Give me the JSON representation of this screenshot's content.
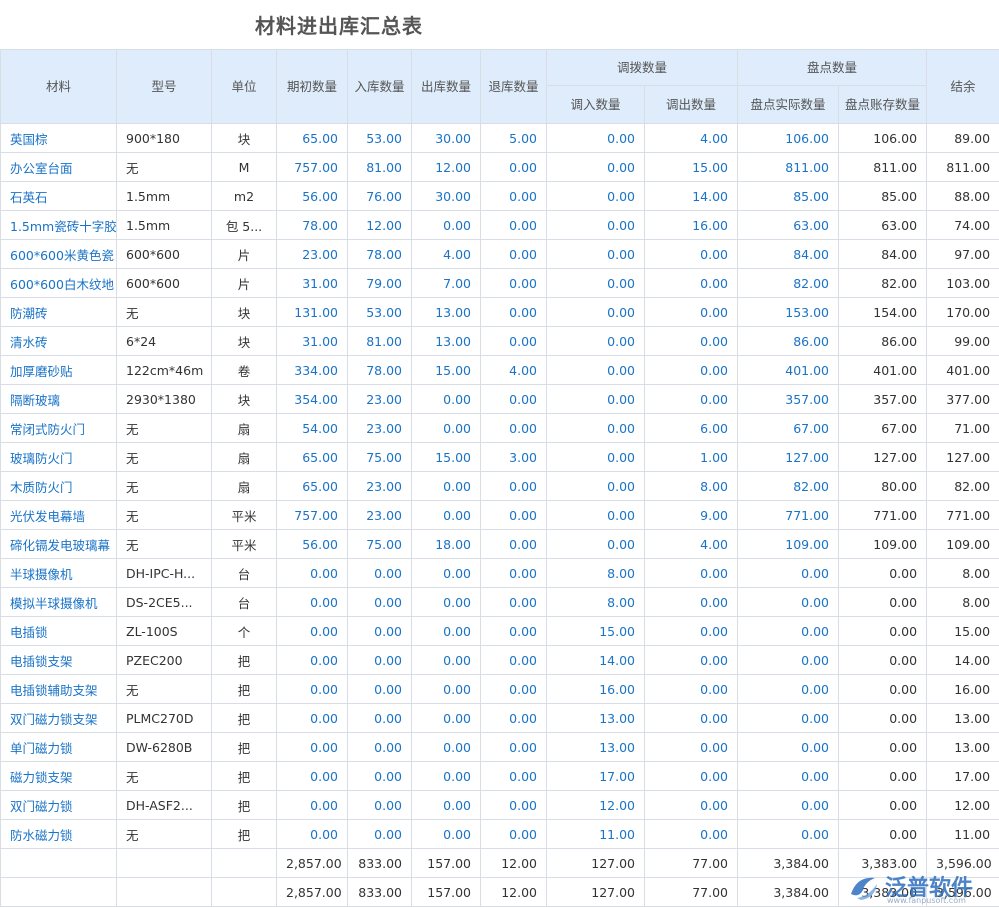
{
  "page_title": "材料进出库汇总表",
  "header": {
    "material": "材料",
    "model": "型号",
    "unit": "单位",
    "opening_qty": "期初数量",
    "in_qty": "入库数量",
    "out_qty": "出库数量",
    "return_qty": "退库数量",
    "transfer_group": "调拨数量",
    "transfer_in": "调入数量",
    "transfer_out": "调出数量",
    "inventory_group": "盘点数量",
    "inventory_actual": "盘点实际数量",
    "inventory_book": "盘点账存数量",
    "balance": "结余"
  },
  "rows": [
    {
      "material": "英国棕",
      "model": "900*180",
      "unit": "块",
      "opening": "65.00",
      "in": "53.00",
      "out": "30.00",
      "ret": "5.00",
      "tin": "0.00",
      "tout": "4.00",
      "actual": "106.00",
      "book": "106.00",
      "balance": "89.00"
    },
    {
      "material": "办公室台面",
      "model": "无",
      "unit": "M",
      "opening": "757.00",
      "in": "81.00",
      "out": "12.00",
      "ret": "0.00",
      "tin": "0.00",
      "tout": "15.00",
      "actual": "811.00",
      "book": "811.00",
      "balance": "811.00"
    },
    {
      "material": "石英石",
      "model": "1.5mm",
      "unit": "m2",
      "opening": "56.00",
      "in": "76.00",
      "out": "30.00",
      "ret": "0.00",
      "tin": "0.00",
      "tout": "14.00",
      "actual": "85.00",
      "book": "85.00",
      "balance": "88.00"
    },
    {
      "material": "1.5mm瓷砖十字胶",
      "model": "1.5mm",
      "unit": "包 5...",
      "opening": "78.00",
      "in": "12.00",
      "out": "0.00",
      "ret": "0.00",
      "tin": "0.00",
      "tout": "16.00",
      "actual": "63.00",
      "book": "63.00",
      "balance": "74.00"
    },
    {
      "material": "600*600米黄色瓷",
      "model": "600*600",
      "unit": "片",
      "opening": "23.00",
      "in": "78.00",
      "out": "4.00",
      "ret": "0.00",
      "tin": "0.00",
      "tout": "0.00",
      "actual": "84.00",
      "book": "84.00",
      "balance": "97.00"
    },
    {
      "material": "600*600白木纹地",
      "model": "600*600",
      "unit": "片",
      "opening": "31.00",
      "in": "79.00",
      "out": "7.00",
      "ret": "0.00",
      "tin": "0.00",
      "tout": "0.00",
      "actual": "82.00",
      "book": "82.00",
      "balance": "103.00"
    },
    {
      "material": "防潮砖",
      "model": "无",
      "unit": "块",
      "opening": "131.00",
      "in": "53.00",
      "out": "13.00",
      "ret": "0.00",
      "tin": "0.00",
      "tout": "0.00",
      "actual": "153.00",
      "book": "154.00",
      "balance": "170.00"
    },
    {
      "material": "清水砖",
      "model": "6*24",
      "unit": "块",
      "opening": "31.00",
      "in": "81.00",
      "out": "13.00",
      "ret": "0.00",
      "tin": "0.00",
      "tout": "0.00",
      "actual": "86.00",
      "book": "86.00",
      "balance": "99.00"
    },
    {
      "material": "加厚磨砂贴",
      "model": "122cm*46m",
      "unit": "卷",
      "opening": "334.00",
      "in": "78.00",
      "out": "15.00",
      "ret": "4.00",
      "tin": "0.00",
      "tout": "0.00",
      "actual": "401.00",
      "book": "401.00",
      "balance": "401.00"
    },
    {
      "material": "隔断玻璃",
      "model": "2930*1380",
      "unit": "块",
      "opening": "354.00",
      "in": "23.00",
      "out": "0.00",
      "ret": "0.00",
      "tin": "0.00",
      "tout": "0.00",
      "actual": "357.00",
      "book": "357.00",
      "balance": "377.00"
    },
    {
      "material": "常闭式防火门",
      "model": "无",
      "unit": "扇",
      "opening": "54.00",
      "in": "23.00",
      "out": "0.00",
      "ret": "0.00",
      "tin": "0.00",
      "tout": "6.00",
      "actual": "67.00",
      "book": "67.00",
      "balance": "71.00"
    },
    {
      "material": "玻璃防火门",
      "model": "无",
      "unit": "扇",
      "opening": "65.00",
      "in": "75.00",
      "out": "15.00",
      "ret": "3.00",
      "tin": "0.00",
      "tout": "1.00",
      "actual": "127.00",
      "book": "127.00",
      "balance": "127.00"
    },
    {
      "material": "木质防火门",
      "model": "无",
      "unit": "扇",
      "opening": "65.00",
      "in": "23.00",
      "out": "0.00",
      "ret": "0.00",
      "tin": "0.00",
      "tout": "8.00",
      "actual": "82.00",
      "book": "80.00",
      "balance": "82.00"
    },
    {
      "material": "光伏发电幕墙",
      "model": "无",
      "unit": "平米",
      "opening": "757.00",
      "in": "23.00",
      "out": "0.00",
      "ret": "0.00",
      "tin": "0.00",
      "tout": "9.00",
      "actual": "771.00",
      "book": "771.00",
      "balance": "771.00"
    },
    {
      "material": "碲化镉发电玻璃幕",
      "model": "无",
      "unit": "平米",
      "opening": "56.00",
      "in": "75.00",
      "out": "18.00",
      "ret": "0.00",
      "tin": "0.00",
      "tout": "4.00",
      "actual": "109.00",
      "book": "109.00",
      "balance": "109.00"
    },
    {
      "material": "半球摄像机",
      "model": "DH-IPC-H...",
      "unit": "台",
      "opening": "0.00",
      "in": "0.00",
      "out": "0.00",
      "ret": "0.00",
      "tin": "8.00",
      "tout": "0.00",
      "actual": "0.00",
      "book": "0.00",
      "balance": "8.00"
    },
    {
      "material": "模拟半球摄像机",
      "model": "DS-2CE5...",
      "unit": "台",
      "opening": "0.00",
      "in": "0.00",
      "out": "0.00",
      "ret": "0.00",
      "tin": "8.00",
      "tout": "0.00",
      "actual": "0.00",
      "book": "0.00",
      "balance": "8.00"
    },
    {
      "material": "电插锁",
      "model": "ZL-100S",
      "unit": "个",
      "opening": "0.00",
      "in": "0.00",
      "out": "0.00",
      "ret": "0.00",
      "tin": "15.00",
      "tout": "0.00",
      "actual": "0.00",
      "book": "0.00",
      "balance": "15.00"
    },
    {
      "material": "电插锁支架",
      "model": "PZEC200",
      "unit": "把",
      "opening": "0.00",
      "in": "0.00",
      "out": "0.00",
      "ret": "0.00",
      "tin": "14.00",
      "tout": "0.00",
      "actual": "0.00",
      "book": "0.00",
      "balance": "14.00"
    },
    {
      "material": "电插锁辅助支架",
      "model": "无",
      "unit": "把",
      "opening": "0.00",
      "in": "0.00",
      "out": "0.00",
      "ret": "0.00",
      "tin": "16.00",
      "tout": "0.00",
      "actual": "0.00",
      "book": "0.00",
      "balance": "16.00"
    },
    {
      "material": "双门磁力锁支架",
      "model": "PLMC270D",
      "unit": "把",
      "opening": "0.00",
      "in": "0.00",
      "out": "0.00",
      "ret": "0.00",
      "tin": "13.00",
      "tout": "0.00",
      "actual": "0.00",
      "book": "0.00",
      "balance": "13.00"
    },
    {
      "material": "单门磁力锁",
      "model": "DW-6280B",
      "unit": "把",
      "opening": "0.00",
      "in": "0.00",
      "out": "0.00",
      "ret": "0.00",
      "tin": "13.00",
      "tout": "0.00",
      "actual": "0.00",
      "book": "0.00",
      "balance": "13.00"
    },
    {
      "material": "磁力锁支架",
      "model": "无",
      "unit": "把",
      "opening": "0.00",
      "in": "0.00",
      "out": "0.00",
      "ret": "0.00",
      "tin": "17.00",
      "tout": "0.00",
      "actual": "0.00",
      "book": "0.00",
      "balance": "17.00"
    },
    {
      "material": "双门磁力锁",
      "model": "DH-ASF2...",
      "unit": "把",
      "opening": "0.00",
      "in": "0.00",
      "out": "0.00",
      "ret": "0.00",
      "tin": "12.00",
      "tout": "0.00",
      "actual": "0.00",
      "book": "0.00",
      "balance": "12.00"
    },
    {
      "material": "防水磁力锁",
      "model": "无",
      "unit": "把",
      "opening": "0.00",
      "in": "0.00",
      "out": "0.00",
      "ret": "0.00",
      "tin": "11.00",
      "tout": "0.00",
      "actual": "0.00",
      "book": "0.00",
      "balance": "11.00"
    }
  ],
  "totals": [
    {
      "opening": "2,857.00",
      "in": "833.00",
      "out": "157.00",
      "ret": "12.00",
      "tin": "127.00",
      "tout": "77.00",
      "actual": "3,384.00",
      "book": "3,383.00",
      "balance": "3,596.00"
    },
    {
      "opening": "2,857.00",
      "in": "833.00",
      "out": "157.00",
      "ret": "12.00",
      "tin": "127.00",
      "tout": "77.00",
      "actual": "3,384.00",
      "book": "3,383.00",
      "balance": "3,596.00"
    }
  ],
  "watermark": {
    "text": "泛普软件",
    "url": "www.fanpusoft.com",
    "logo_icon": "fanpu-logo-icon"
  },
  "colors": {
    "header_bg": "#deecfb",
    "link": "#1a73c7",
    "border": "#d9dee6",
    "watermark": "#2f6fbf"
  }
}
